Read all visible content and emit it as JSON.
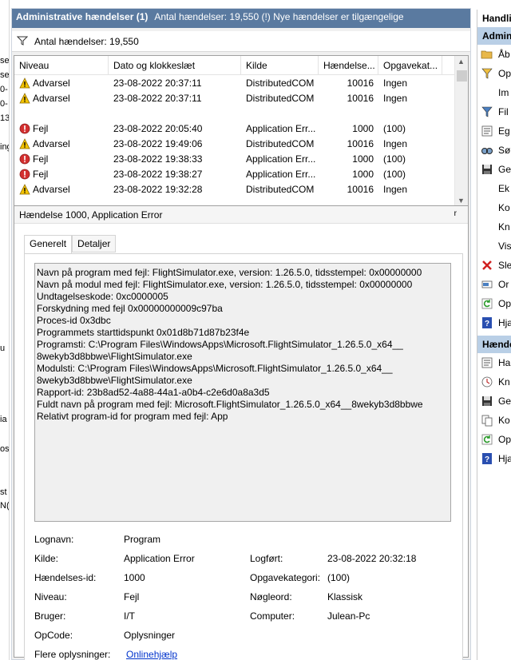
{
  "left_fragments": [
    "se",
    "se",
    "0-",
    "0-",
    "13",
    "ing f",
    "u",
    "ia",
    "os",
    "st",
    "N("
  ],
  "title": {
    "main": "Administrative hændelser (1)",
    "rest": "Antal hændelser: 19,550 (!) Nye hændelser er tilgængelige"
  },
  "filter": {
    "count_label": "Antal hændelser: 19,550"
  },
  "columns": [
    "Niveau",
    "Dato og klokkeslæt",
    "Kilde",
    "Hændelse...",
    "Opgavekat..."
  ],
  "events": [
    {
      "level": "Advarsel",
      "icon": "warning-icon",
      "datetime": "23-08-2022 20:37:11",
      "source": "DistributedCOM",
      "id": "10016",
      "task": "Ingen"
    },
    {
      "level": "Advarsel",
      "icon": "warning-icon",
      "datetime": "23-08-2022 20:37:11",
      "source": "DistributedCOM",
      "id": "10016",
      "task": "Ingen"
    },
    {
      "level": "",
      "icon": "",
      "datetime": "",
      "source": "",
      "id": "",
      "task": ""
    },
    {
      "level": "Fejl",
      "icon": "error-icon",
      "datetime": "23-08-2022 20:05:40",
      "source": "Application Err...",
      "id": "1000",
      "task": "(100)"
    },
    {
      "level": "Advarsel",
      "icon": "warning-icon",
      "datetime": "23-08-2022 19:49:06",
      "source": "DistributedCOM",
      "id": "10016",
      "task": "Ingen"
    },
    {
      "level": "Fejl",
      "icon": "error-icon",
      "datetime": "23-08-2022 19:38:33",
      "source": "Application Err...",
      "id": "1000",
      "task": "(100)"
    },
    {
      "level": "Fejl",
      "icon": "error-icon",
      "datetime": "23-08-2022 19:38:27",
      "source": "Application Err...",
      "id": "1000",
      "task": "(100)"
    },
    {
      "level": "Advarsel",
      "icon": "warning-icon",
      "datetime": "23-08-2022 19:32:28",
      "source": "DistributedCOM",
      "id": "10016",
      "task": "Ingen"
    }
  ],
  "detail": {
    "header": "Hændelse 1000, Application Error",
    "close_glyph": "r",
    "tabs": [
      "Generelt",
      "Detaljer"
    ],
    "description": [
      "Navn på program med fejl: FlightSimulator.exe, version: 1.26.5.0, tidsstempel: 0x00000000",
      "Navn på modul med fejl: FlightSimulator.exe, version: 1.26.5.0, tidsstempel: 0x00000000",
      "Undtagelseskode: 0xc0000005",
      "Forskydning med fejl 0x00000000009c97ba",
      "Proces-id 0x3dbc",
      "Programmets starttidspunkt 0x01d8b71d87b23f4e",
      "Programsti: C:\\Program Files\\WindowsApps\\Microsoft.FlightSimulator_1.26.5.0_x64__",
      "8wekyb3d8bbwe\\FlightSimulator.exe",
      "Modulsti: C:\\Program Files\\WindowsApps\\Microsoft.FlightSimulator_1.26.5.0_x64__",
      "8wekyb3d8bbwe\\FlightSimulator.exe",
      "Rapport-id: 23b8ad52-4a88-44a1-a0b4-c2e6d0a8a3d5",
      "Fuldt navn på program med fejl: Microsoft.FlightSimulator_1.26.5.0_x64__8wekyb3d8bbwe",
      "Relativt program-id for program med fejl: App"
    ],
    "props": {
      "log_label": "Lognavn:",
      "log_value": "Program",
      "source_label": "Kilde:",
      "source_value": "Application Error",
      "logged_label": "Logført:",
      "logged_value": "23-08-2022 20:32:18",
      "eventid_label": "Hændelses-id:",
      "eventid_value": "1000",
      "taskcat_label": "Opgavekategori:",
      "taskcat_value": "(100)",
      "level_label": "Niveau:",
      "level_value": "Fejl",
      "keywords_label": "Nøgleord:",
      "keywords_value": "Klassisk",
      "user_label": "Bruger:",
      "user_value": "I/T",
      "computer_label": "Computer:",
      "computer_value": "Julean-Pc",
      "opcode_label": "OpCode:",
      "opcode_value": "Oplysninger",
      "more_label": "Flere oplysninger:",
      "more_link": "Onlinehjælp"
    }
  },
  "actions": {
    "header": "Handlin",
    "section1": "Admin",
    "items1": [
      {
        "label": "Åb",
        "icon": "folder-open-icon"
      },
      {
        "label": "Op",
        "icon": "filter-create-icon"
      },
      {
        "label": "Im",
        "icon": ""
      },
      {
        "label": "Fil",
        "icon": "filter-icon"
      },
      {
        "label": "Eg",
        "icon": "properties-icon"
      },
      {
        "label": "Sø",
        "icon": "find-icon"
      },
      {
        "label": "Ge",
        "icon": "save-icon"
      },
      {
        "label": "Ek",
        "icon": ""
      },
      {
        "label": "Ko",
        "icon": ""
      },
      {
        "label": "Kn",
        "icon": ""
      },
      {
        "label": "Vis",
        "icon": ""
      },
      {
        "label": "Sle",
        "icon": "delete-icon"
      },
      {
        "label": "Or",
        "icon": "rename-icon"
      },
      {
        "label": "Op",
        "icon": "refresh-icon"
      },
      {
        "label": "Hjæ",
        "icon": "help-icon"
      }
    ],
    "section2": "Hænde",
    "items2": [
      {
        "label": "Ha",
        "icon": "event-properties-icon"
      },
      {
        "label": "Kn",
        "icon": "attach-task-icon"
      },
      {
        "label": "Ge",
        "icon": "save-icon"
      },
      {
        "label": "Ko",
        "icon": "copy-icon"
      },
      {
        "label": "Op",
        "icon": "refresh-icon"
      },
      {
        "label": "Hjæ",
        "icon": "help-icon"
      }
    ]
  }
}
